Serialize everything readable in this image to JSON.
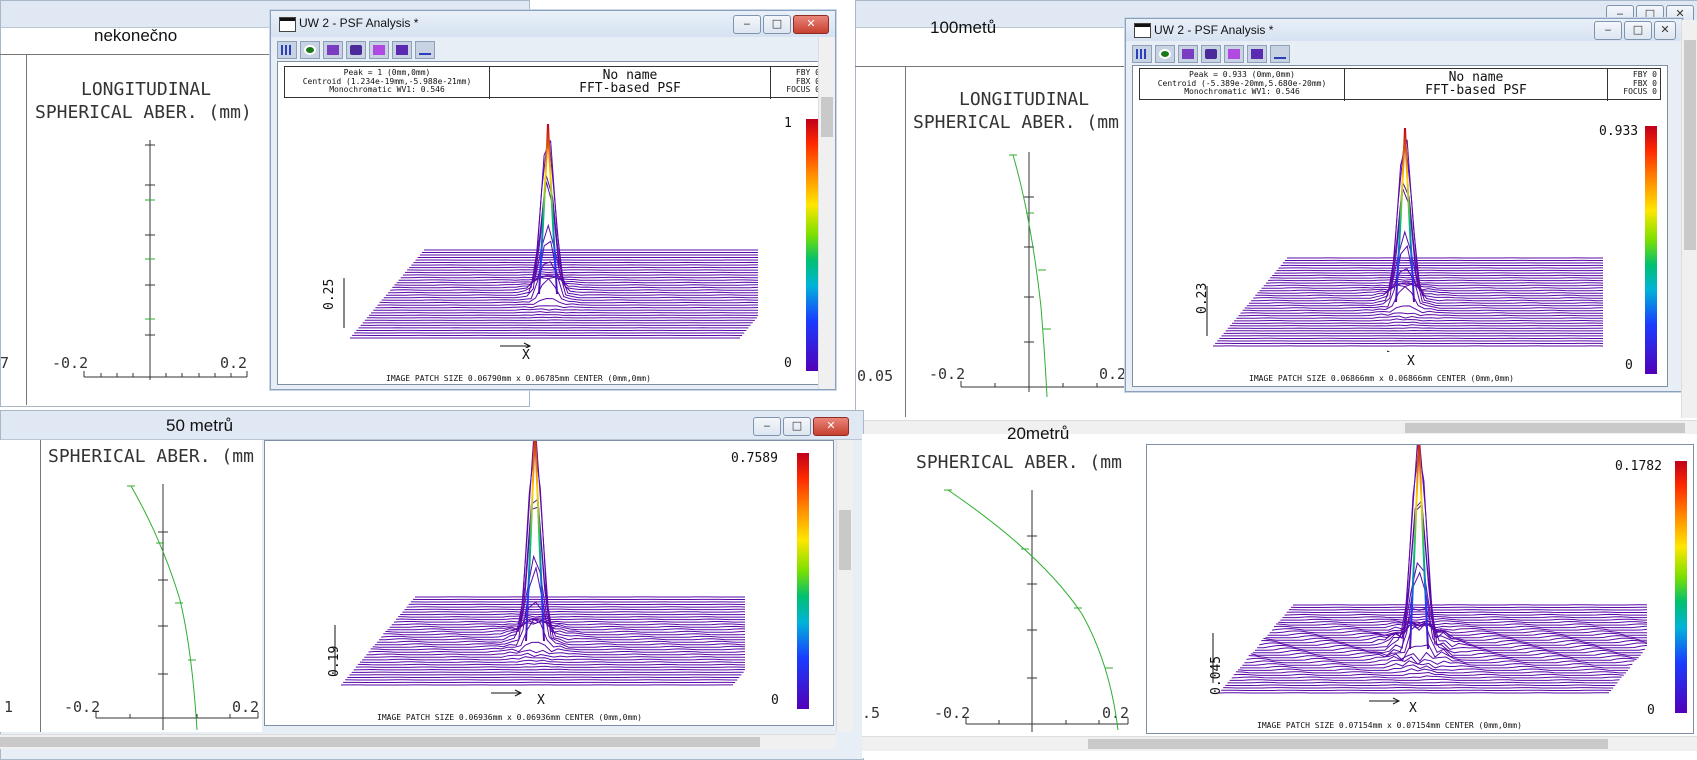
{
  "quadrants": [
    {
      "id": "q1",
      "title": "nekonečno",
      "plot": {
        "line1": "LONGITUDINAL",
        "line2": "SPHERICAL ABER. (mm)",
        "xmin": "-0.2",
        "xmax": "0.2",
        "left_edge": "7"
      },
      "psf": {
        "title": "UW 2 - PSF Analysis *",
        "info": [
          "Peak = 1 (0mm,0mm)",
          "Centroid (1.234e-19mm,-5.988e-21mm)",
          "Monochromatic WV1: 0.546"
        ],
        "center_line1": "No name",
        "center_line2": "FFT-based PSF",
        "right": [
          "FBY 0",
          "FBX 0",
          "FOCUS 0"
        ],
        "max": "1",
        "min": "0",
        "zscale": "0.25",
        "footer": "IMAGE PATCH SIZE 0.06790mm x 0.06785mm    CENTER (0mm,0mm)",
        "axis": "X"
      }
    },
    {
      "id": "q2",
      "title": "100metů",
      "plot": {
        "line1": "LONGITUDINAL",
        "line2": "SPHERICAL ABER. (mm",
        "xmin": "-0.2",
        "xmax": "0.2",
        "left_edge": "0.05"
      },
      "psf": {
        "title": "UW 2 - PSF Analysis *",
        "info": [
          "Peak = 0.933 (0mm,0mm)",
          "Centroid (-5.389e-20mm,5.680e-20mm)",
          "Monochromatic WV1: 0.546"
        ],
        "center_line1": "No name",
        "center_line2": "FFT-based PSF",
        "right": [
          "FBY 0",
          "FBX 0",
          "FOCUS 0"
        ],
        "max": "0.933",
        "min": "0",
        "zscale": "0.23",
        "footer": "IMAGE PATCH SIZE 0.06866mm x 0.06866mm    CENTER (0mm,0mm)",
        "axis": "X"
      }
    },
    {
      "id": "q3",
      "title": "50 metrů",
      "plot": {
        "line2": "SPHERICAL ABER. (mm",
        "xmin": "-0.2",
        "xmax": "0.2",
        "left_edge": "1"
      },
      "psf": {
        "max": "0.7589",
        "min": "0",
        "zscale": "0.19",
        "footer": "IMAGE PATCH SIZE 0.06936mm x 0.06936mm    CENTER (0mm,0mm)",
        "axis": "X"
      }
    },
    {
      "id": "q4",
      "title": "20metrů",
      "plot": {
        "line2": "SPHERICAL ABER. (mm",
        "xmin": "-0.2",
        "xmax": "0.2",
        "left_edge": ".5"
      },
      "psf": {
        "max": "0.1782",
        "min": "0",
        "zscale": "0.045",
        "footer": "IMAGE PATCH SIZE 0.07154mm x 0.07154mm    CENTER (0mm,0mm)",
        "axis": "X"
      }
    }
  ],
  "window_buttons": {
    "minimize": "‒",
    "maximize": "□",
    "close": "✕"
  },
  "colors": {
    "psf_line": "#5a0aa8",
    "aberration_curve": "#2fae2f",
    "title_bar": "#d6e2f1",
    "close_button": "#c7402f"
  },
  "icons": [
    "app-icon",
    "grid-icon",
    "target-icon",
    "text-icon",
    "circle-icon",
    "lines-icon",
    "dot-icon",
    "curve-icon"
  ]
}
